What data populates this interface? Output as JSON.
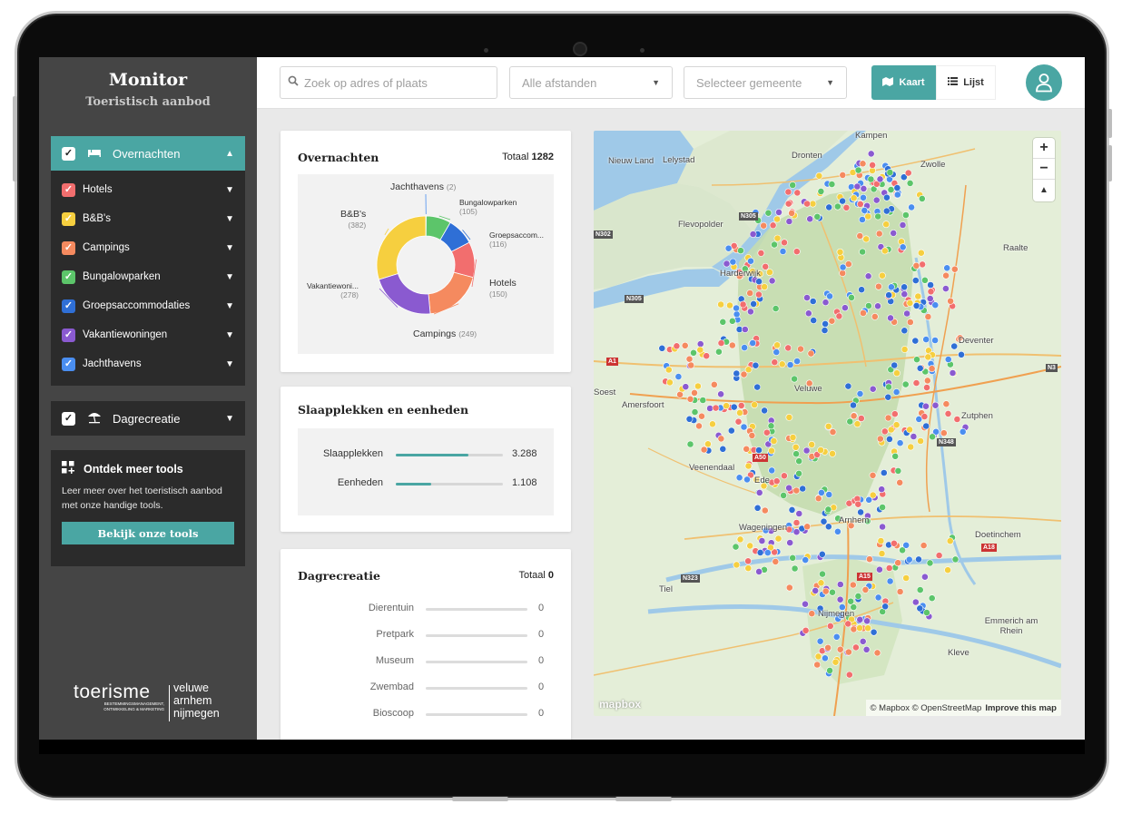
{
  "sidebar": {
    "title": "Monitor",
    "subtitle": "Toeristisch aanbod",
    "overnachten": {
      "label": "Overnachten",
      "items": [
        {
          "label": "Hotels",
          "color": "#f26e6e"
        },
        {
          "label": "B&B's",
          "color": "#f6cf3f"
        },
        {
          "label": "Campings",
          "color": "#f58a5f"
        },
        {
          "label": "Bungalowparken",
          "color": "#5cc56a"
        },
        {
          "label": "Groepsaccommodaties",
          "color": "#2f6fd6"
        },
        {
          "label": "Vakantiewoningen",
          "color": "#8a5ad0"
        },
        {
          "label": "Jachthavens",
          "color": "#4a8ef0"
        }
      ]
    },
    "dagrecreatie": {
      "label": "Dagrecreatie"
    },
    "tools": {
      "title": "Ontdek meer tools",
      "text": "Leer meer over het toeristisch aanbod met onze handige tools.",
      "button": "Bekijk onze tools"
    },
    "logo": {
      "main": "toerisme",
      "sub": "BESTEMMINGSMANAGEMENT, ONTWIKKELING & MARKETING",
      "right1": "veluwe",
      "right2": "arnhem",
      "right3": "nijmegen"
    }
  },
  "topbar": {
    "search_placeholder": "Zoek op adres of plaats",
    "distance": "Alle afstanden",
    "municipality": "Selecteer gemeente",
    "kaart": "Kaart",
    "lijst": "Lijst"
  },
  "overnachten_card": {
    "title": "Overnachten",
    "total_label": "Totaal",
    "total_value": "1282",
    "chart_data": {
      "type": "pie",
      "categories": [
        "Jachthavens",
        "Bungalowparken",
        "Groepsaccom...",
        "Hotels",
        "Campings",
        "Vakantiewoni...",
        "B&B's"
      ],
      "values": [
        2,
        105,
        116,
        150,
        249,
        278,
        382
      ],
      "value_labels": [
        "(2)",
        "(105)",
        "(116)",
        "(150)",
        "(249)",
        "(278)",
        "(382)"
      ],
      "colors": [
        "#4a8ef0",
        "#5cc56a",
        "#2f6fd6",
        "#f26e6e",
        "#f58a5f",
        "#8a5ad0",
        "#f6cf3f"
      ]
    }
  },
  "slaap_card": {
    "title": "Slaapplekken en eenheden",
    "rows": [
      {
        "label": "Slaapplekken",
        "value": "3.288",
        "fill": 0.68
      },
      {
        "label": "Eenheden",
        "value": "1.108",
        "fill": 0.33
      }
    ]
  },
  "dagrecreatie_card": {
    "title": "Dagrecreatie",
    "total_label": "Totaal",
    "total_value": "0",
    "rows": [
      {
        "label": "Dierentuin",
        "value": "0"
      },
      {
        "label": "Pretpark",
        "value": "0"
      },
      {
        "label": "Museum",
        "value": "0"
      },
      {
        "label": "Zwembad",
        "value": "0"
      },
      {
        "label": "Bioscoop",
        "value": "0"
      }
    ]
  },
  "map": {
    "places": [
      "Kampen",
      "Dronten",
      "Zwolle",
      "Nieuw Land",
      "Lelystad",
      "Flevopolder",
      "Harderwijk",
      "Raalte",
      "Deventer",
      "Soest",
      "Amersfoort",
      "Veluwe",
      "Zutphen",
      "Veenendaal",
      "Ede",
      "Wageningen",
      "Arnhem",
      "Doetinchem",
      "Tiel",
      "Nijmegen",
      "Emmerich am Rhein",
      "Kleve"
    ],
    "roads": [
      "N305",
      "N302",
      "N305",
      "A1",
      "N348",
      "N3",
      "A18",
      "A15",
      "N323",
      "A50"
    ],
    "zoom_in": "+",
    "zoom_out": "−",
    "compass": "▲",
    "logo": "mapbox",
    "attribution": "© Mapbox © OpenStreetMap",
    "improve": "Improve this map"
  }
}
